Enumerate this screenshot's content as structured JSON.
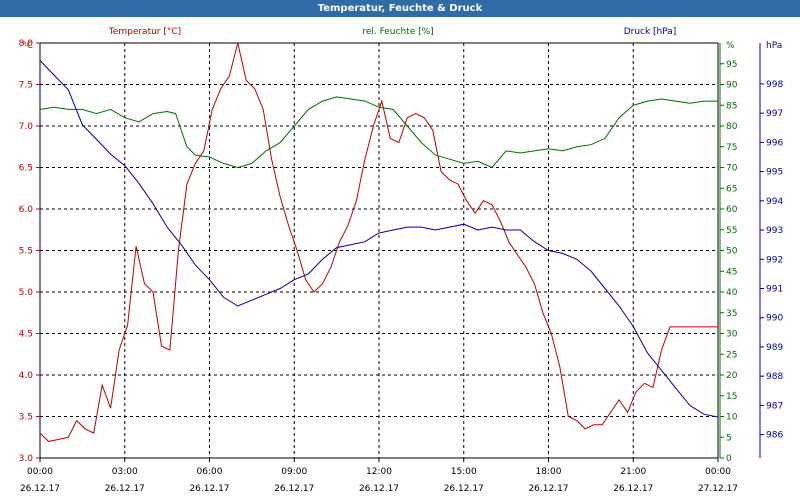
{
  "window": {
    "title": "Temperatur, Feuchte & Druck"
  },
  "colors": {
    "temperature": "#c00000",
    "humidity": "#007000",
    "pressure": "#0000a0",
    "title_bar": "#2f6ba6"
  },
  "chart_data": {
    "type": "line",
    "title": "Temperatur, Feuchte & Druck",
    "grid": true,
    "x_ticks": [
      {
        "time": "00:00",
        "date": "26.12.17"
      },
      {
        "time": "03:00",
        "date": "26.12.17"
      },
      {
        "time": "06:00",
        "date": "26.12.17"
      },
      {
        "time": "09:00",
        "date": "26.12.17"
      },
      {
        "time": "12:00",
        "date": "26.12.17"
      },
      {
        "time": "15:00",
        "date": "26.12.17"
      },
      {
        "time": "18:00",
        "date": "26.12.17"
      },
      {
        "time": "21:00",
        "date": "26.12.17"
      },
      {
        "time": "00:00",
        "date": "27.12.17"
      }
    ],
    "axes": {
      "temperature": {
        "label": "Temperatur [°C]",
        "unit": "°C",
        "ylim": [
          3.0,
          8.0
        ],
        "ticks": [
          "3.0",
          "3.5",
          "4.0",
          "4.5",
          "5.0",
          "5.5",
          "6.0",
          "6.5",
          "7.0",
          "7.5",
          "8.0"
        ]
      },
      "humidity": {
        "label": "rel. Feuchte [%]",
        "unit": "%",
        "ylim": [
          0,
          100
        ],
        "ticks": [
          "0",
          "5",
          "10",
          "15",
          "20",
          "25",
          "30",
          "35",
          "40",
          "45",
          "50",
          "55",
          "60",
          "65",
          "70",
          "75",
          "80",
          "85",
          "90",
          "95"
        ]
      },
      "pressure": {
        "label": "Druck [hPa]",
        "unit": "hPa",
        "ylim": [
          985.2,
          999.4
        ],
        "ticks": [
          "986",
          "987",
          "988",
          "989",
          "990",
          "991",
          "992",
          "993",
          "994",
          "995",
          "996",
          "997",
          "998"
        ]
      }
    },
    "series": [
      {
        "name": "Temperatur [°C]",
        "axis": "temperature",
        "x": [
          0,
          0.3,
          0.6,
          1,
          1.3,
          1.6,
          1.9,
          2.2,
          2.5,
          2.8,
          3.1,
          3.4,
          3.7,
          4,
          4.3,
          4.6,
          4.9,
          5.2,
          5.5,
          5.8,
          6.1,
          6.4,
          6.7,
          7,
          7.3,
          7.6,
          7.9,
          8.2,
          8.5,
          8.8,
          9.1,
          9.4,
          9.7,
          10,
          10.3,
          10.6,
          10.9,
          11.2,
          11.5,
          11.8,
          12.1,
          12.4,
          12.7,
          13,
          13.3,
          13.6,
          13.9,
          14.2,
          14.5,
          14.8,
          15.1,
          15.4,
          15.7,
          16,
          16.3,
          16.6,
          16.9,
          17.2,
          17.5,
          17.8,
          18.1,
          18.4,
          18.7,
          19,
          19.3,
          19.6,
          19.9,
          20.2,
          20.5,
          20.8,
          21.1,
          21.4,
          21.7,
          22,
          22.3,
          22.6,
          22.9,
          23.2,
          23.5,
          23.8,
          24
        ],
        "values": [
          3.3,
          3.2,
          3.22,
          3.25,
          3.45,
          3.35,
          3.3,
          3.88,
          3.6,
          4.3,
          4.6,
          5.55,
          5.1,
          5.0,
          4.35,
          4.3,
          5.5,
          6.3,
          6.55,
          6.7,
          7.2,
          7.45,
          7.6,
          8.0,
          7.55,
          7.45,
          7.2,
          6.6,
          6.15,
          5.8,
          5.5,
          5.15,
          5.0,
          5.1,
          5.3,
          5.6,
          5.8,
          6.1,
          6.6,
          7.0,
          7.3,
          6.85,
          6.8,
          7.1,
          7.15,
          7.1,
          6.95,
          6.45,
          6.35,
          6.3,
          6.1,
          5.95,
          6.1,
          6.05,
          5.85,
          5.6,
          5.45,
          5.3,
          5.1,
          4.75,
          4.5,
          4.1,
          3.5,
          3.45,
          3.35,
          3.4,
          3.4,
          3.55,
          3.7,
          3.55,
          3.8,
          3.9,
          3.85,
          4.3,
          4.58,
          4.58,
          4.58,
          4.58,
          4.58,
          4.58,
          4.58
        ]
      },
      {
        "name": "rel. Feuchte [%]",
        "axis": "humidity",
        "x": [
          0,
          0.5,
          1,
          1.5,
          2,
          2.5,
          3,
          3.5,
          4,
          4.5,
          4.8,
          5.2,
          5.5,
          6,
          6.5,
          7,
          7.5,
          8,
          8.5,
          9,
          9.5,
          10,
          10.5,
          11,
          11.5,
          12,
          12.5,
          13,
          13.5,
          14,
          14.5,
          15,
          15.5,
          16,
          16.5,
          17,
          17.5,
          18,
          18.5,
          19,
          19.5,
          20,
          20.5,
          21,
          21.5,
          22,
          22.5,
          23,
          23.5,
          24
        ],
        "values": [
          84,
          84.5,
          84,
          84,
          83,
          84,
          82,
          81,
          83,
          83.5,
          83,
          75,
          73,
          72.5,
          71,
          70,
          71,
          74,
          76,
          80,
          84,
          86,
          87,
          86.5,
          86,
          84.5,
          84,
          80,
          76,
          73,
          72,
          71,
          71.5,
          70,
          74,
          73.5,
          74,
          74.5,
          74,
          75,
          75.5,
          77,
          82,
          85,
          86,
          86.5,
          86,
          85.5,
          86,
          86
        ]
      },
      {
        "name": "Druck [hPa]",
        "axis": "pressure",
        "x": [
          0,
          0.5,
          1,
          1.5,
          2,
          2.5,
          3,
          3.5,
          4,
          4.5,
          5,
          5.5,
          6,
          6.5,
          7,
          7.5,
          8,
          8.5,
          9,
          9.5,
          10,
          10.5,
          11,
          11.5,
          12,
          12.5,
          13,
          13.5,
          14,
          14.5,
          15,
          15.5,
          16,
          16.5,
          17,
          17.5,
          18,
          18.5,
          19,
          19.5,
          20,
          20.5,
          21,
          21.5,
          22,
          22.5,
          23,
          23.5,
          24
        ],
        "values": [
          998.8,
          998.3,
          997.8,
          996.6,
          996.1,
          995.6,
          995.2,
          994.6,
          993.9,
          993.1,
          992.5,
          991.8,
          991.3,
          990.7,
          990.4,
          990.6,
          990.8,
          991.0,
          991.3,
          991.5,
          992.0,
          992.4,
          992.5,
          992.6,
          992.9,
          993.0,
          993.1,
          993.1,
          993.0,
          993.1,
          993.2,
          993.0,
          993.1,
          993.0,
          993.0,
          992.6,
          992.3,
          992.2,
          992.0,
          991.6,
          991.0,
          990.4,
          989.7,
          988.8,
          988.2,
          987.6,
          987.0,
          986.7,
          986.6
        ]
      }
    ]
  }
}
